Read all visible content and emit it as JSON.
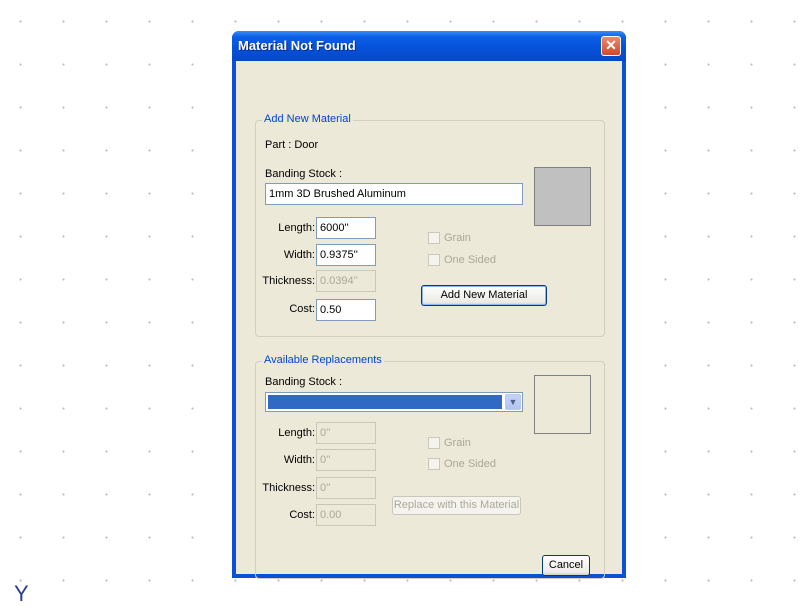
{
  "dialog": {
    "title": "Material Not Found",
    "close_glyph": "✕"
  },
  "add_new": {
    "legend": "Add New Material",
    "part_text": "Part : Door",
    "banding_label": "Banding Stock :",
    "banding_value": "1mm 3D Brushed Aluminum",
    "length_label": "Length:",
    "length_value": "6000''",
    "width_label": "Width:",
    "width_value": "0.9375''",
    "thickness_label": "Thickness:",
    "thickness_value": "0.0394''",
    "cost_label": "Cost:",
    "cost_value": "0.50",
    "grain_label": "Grain",
    "one_sided_label": "One Sided",
    "add_button": "Add New Material",
    "swatch_color": "#c0c0c0"
  },
  "replacements": {
    "legend": "Available Replacements",
    "banding_label": "Banding Stock :",
    "length_label": "Length:",
    "length_value": "0''",
    "width_label": "Width:",
    "width_value": "0''",
    "thickness_label": "Thickness:",
    "thickness_value": "0''",
    "cost_label": "Cost:",
    "cost_value": "0.00",
    "grain_label": "Grain",
    "one_sided_label": "One Sided",
    "replace_button": "Replace with this Material",
    "swatch_color": "#ece9d8"
  },
  "footer": {
    "cancel_button": "Cancel"
  },
  "icons": {
    "dropdown": "chevron-down-icon",
    "close": "close-icon"
  },
  "colors": {
    "title_bar": "#0550d8",
    "dialog_bg": "#ece9d8",
    "selection": "#316ac5",
    "legend_text": "#0046d5"
  }
}
